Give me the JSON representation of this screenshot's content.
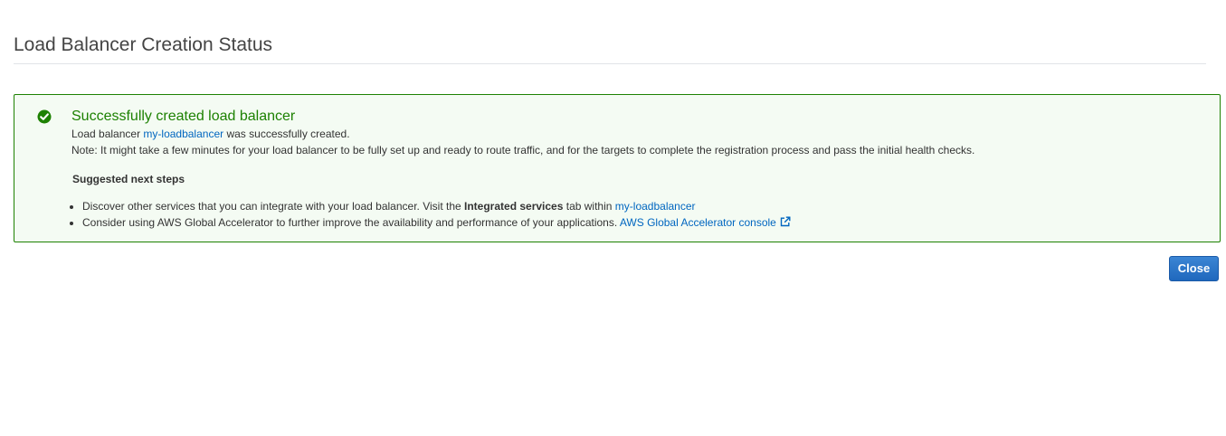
{
  "page": {
    "title": "Load Balancer Creation Status"
  },
  "status": {
    "icon": "check-circle-icon",
    "color": "#1d8102",
    "title": "Successfully created load balancer",
    "line1_prefix": "Load balancer",
    "load_balancer_name": "my-loadbalancer",
    "line1_suffix": "was successfully created.",
    "note": "Note: It might take a few minutes for your load balancer to be fully set up and ready to route traffic, and for the targets to complete the registration process and pass the initial health checks."
  },
  "next_steps": {
    "heading": "Suggested next steps",
    "items": [
      {
        "text_before": "Discover other services that you can integrate with your load balancer. Visit the",
        "bold": "Integrated services",
        "text_after": "tab within",
        "link": "my-loadbalancer"
      },
      {
        "text_before": "Consider using AWS Global Accelerator to further improve the availability and performance of your applications.",
        "link": "AWS Global Accelerator console",
        "link_icon": "external-link-icon"
      }
    ]
  },
  "actions": {
    "close_label": "Close",
    "accent_color": "#1f68bd"
  }
}
